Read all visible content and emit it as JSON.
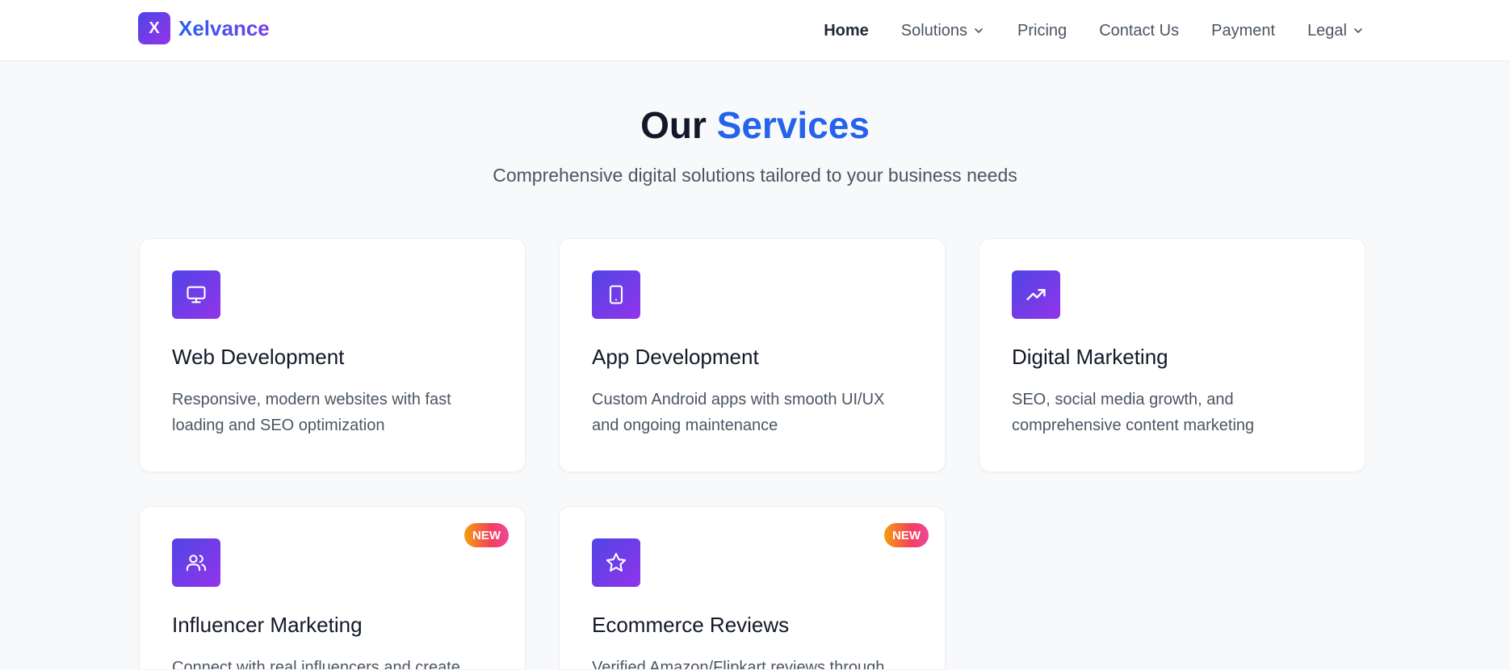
{
  "header": {
    "logo_letter": "X",
    "brand": "Xelvance",
    "nav": [
      {
        "label": "Home",
        "active": true,
        "dropdown": false
      },
      {
        "label": "Solutions",
        "active": false,
        "dropdown": true
      },
      {
        "label": "Pricing",
        "active": false,
        "dropdown": false
      },
      {
        "label": "Contact Us",
        "active": false,
        "dropdown": false
      },
      {
        "label": "Payment",
        "active": false,
        "dropdown": false
      },
      {
        "label": "Legal",
        "active": false,
        "dropdown": true
      }
    ]
  },
  "section": {
    "title_prefix": "Our",
    "title_accent": "Services",
    "subtitle": "Comprehensive digital solutions tailored to your business needs"
  },
  "cards": [
    {
      "icon": "monitor-icon",
      "title": "Web Development",
      "description": "Responsive, modern websites with fast loading and SEO optimization",
      "badge": ""
    },
    {
      "icon": "tablet-icon",
      "title": "App Development",
      "description": "Custom Android apps with smooth UI/UX and ongoing maintenance",
      "badge": ""
    },
    {
      "icon": "trending-up-icon",
      "title": "Digital Marketing",
      "description": "SEO, social media growth, and comprehensive content marketing",
      "badge": ""
    },
    {
      "icon": "users-icon",
      "title": "Influencer Marketing",
      "description": "Connect with real influencers and create",
      "badge": "NEW"
    },
    {
      "icon": "star-icon",
      "title": "Ecommerce Reviews",
      "description": "Verified Amazon/Flipkart reviews through",
      "badge": "NEW"
    }
  ],
  "colors": {
    "accent": "#2563eb",
    "gradient_start": "#4f46e5",
    "gradient_end": "#9333ea",
    "background": "#f8f9fb"
  }
}
